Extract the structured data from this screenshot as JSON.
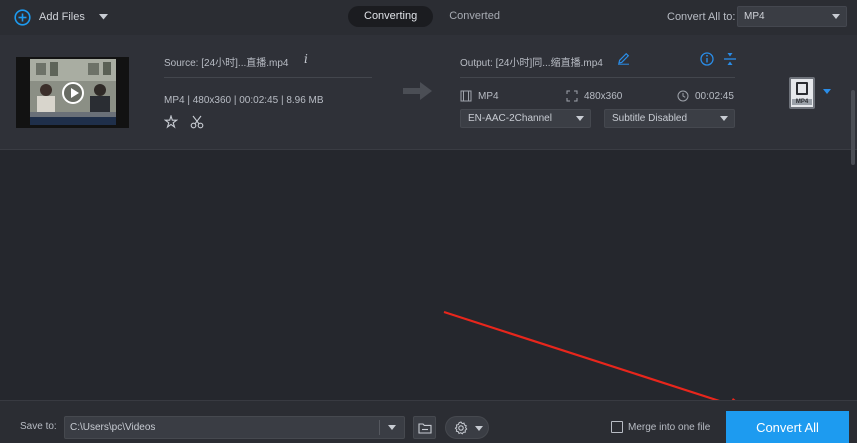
{
  "header": {
    "add_files_label": "Add Files",
    "tabs": [
      {
        "label": "Converting",
        "active": true
      },
      {
        "label": "Converted",
        "active": false
      }
    ],
    "convert_all_to_label": "Convert All to:",
    "convert_all_format": "MP4"
  },
  "file": {
    "source_name": "Source: [24小时]...直播.mp4",
    "source_meta": "MP4 | 480x360 | 00:02:45 | 8.96 MB",
    "output_name": "Output: [24小时]同...缩直播.mp4",
    "output_format": "MP4",
    "output_resolution": "480x360",
    "output_duration": "00:02:45",
    "audio_track": "EN-AAC-2Channel",
    "subtitle": "Subtitle Disabled",
    "format_badge": "MP4"
  },
  "footer": {
    "save_to_label": "Save to:",
    "save_path": "C:\\Users\\pc\\Videos",
    "merge_label": "Merge into one file",
    "merge_checked": false,
    "convert_all_label": "Convert All"
  },
  "colors": {
    "accent": "#1d9bf0",
    "annotation": "#e8261c",
    "background": "#25272d"
  }
}
